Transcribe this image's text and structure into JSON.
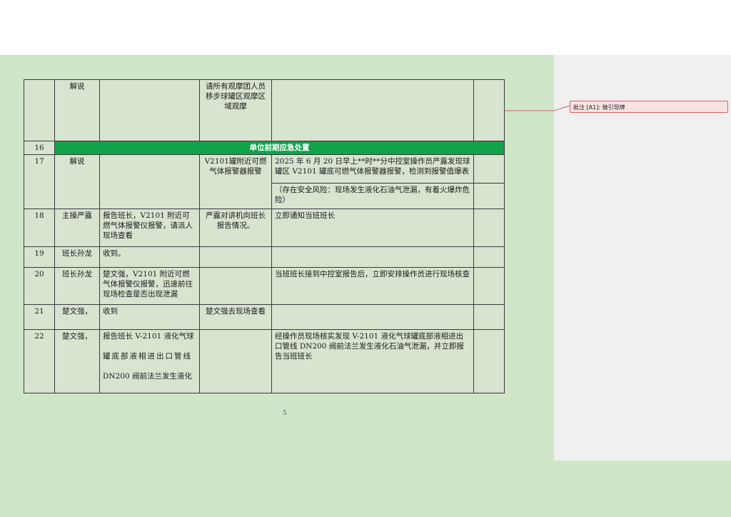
{
  "comment": {
    "label": "批注 [A1]:",
    "text": "做引导牌"
  },
  "table": {
    "row_top": {
      "role": "解说",
      "c3": "请所有观摩团人员移步球罐区观摩区域观摩"
    },
    "row16": {
      "num": "16",
      "banner": "单位前期应急处置"
    },
    "row17": {
      "num": "17",
      "role": "解说",
      "c3": "V2101罐附近可燃气体报警器报警",
      "c4a": "2025 年 6 月 20 日早上**时**分中控室操作员严露发现球罐区 V2101 罐底可燃气体报警器报警，检测到报警值爆表",
      "c4b": "（存在安全风险：现场发生液化石油气泄漏，有着火爆炸危险）"
    },
    "row18": {
      "num": "18",
      "role": "主操严露",
      "c2": "报告班长，V2101 附近可燃气体报警仪报警，请派人现场查看",
      "c3": "严露对讲机向班长报告情况。",
      "c4": "立即通知当班班长"
    },
    "row19": {
      "num": "19",
      "role": "班长孙龙",
      "c2": "收到。"
    },
    "row20": {
      "num": "20",
      "role": "班长孙龙",
      "c2": "楚文强，V2101 附近可燃气体报警仪报警，迅速前往现场检查是否出现泄漏",
      "c4": "当班班长接到中控室报告后，立即安排操作员进行现场核查"
    },
    "row21": {
      "num": "21",
      "role": "楚文强，",
      "c2": "收到",
      "c3": "楚文强去现场查看"
    },
    "row22": {
      "num": "22",
      "role": "楚文强，",
      "c2_l1": "报告班长 V-2101 液化气球",
      "c2_l2": "罐底部液相进出口管线",
      "c2_l3": "DN200 阀前法兰发生液化",
      "c4": "经操作员现场核实发现 V-2101 液化气球罐底部液相进出口管线 DN200 阀前法兰发生液化石油气泄漏，并立即报告当班班长"
    }
  },
  "page_number": "5"
}
